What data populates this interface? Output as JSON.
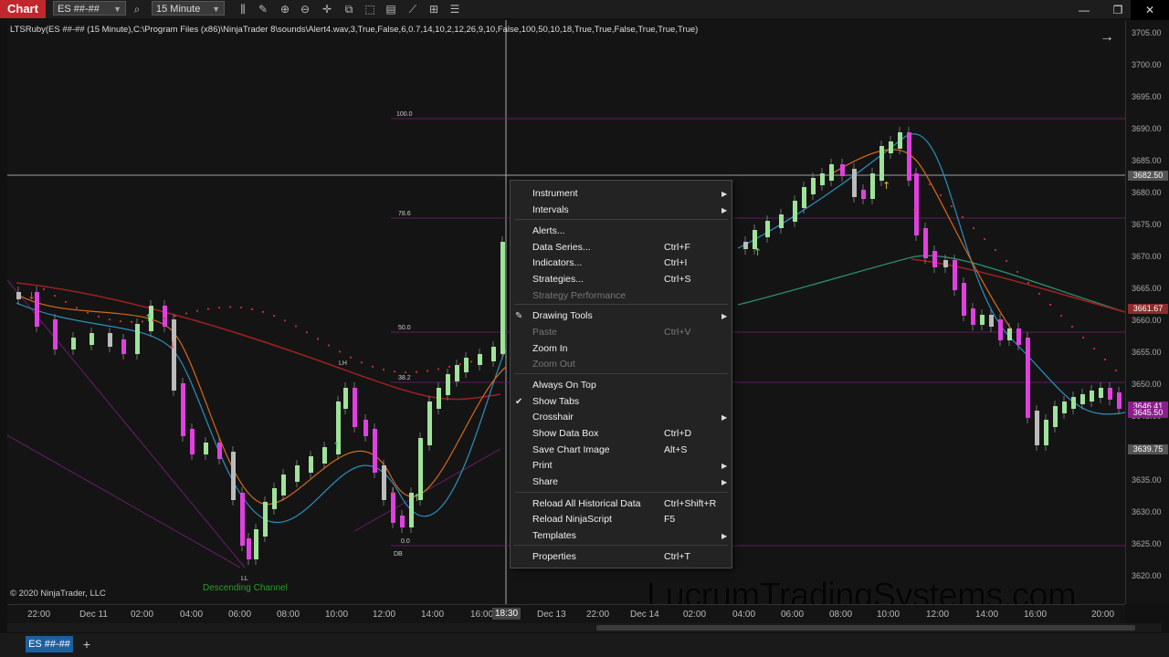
{
  "titlebar": {
    "app_tab": "Chart",
    "instrument": "ES ##-##",
    "interval": "15 Minute",
    "minimize": "—",
    "restore": "❐",
    "close": "✕"
  },
  "chart": {
    "indicator_label": "LTSRuby(ES ##-## (15 Minute),C:\\Program Files (x86)\\NinjaTrader 8\\sounds\\Alert4.wav,3,True,False,6,0.7,14,10,2,12,26,9,10,False,100,50,10,18,True,True,False,True,True,True)",
    "copyright": "© 2020 NinjaTrader, LLC",
    "watermark": "LucrumTradingSystems.com",
    "descending_channel": "Descending Channel",
    "fib_levels": [
      "100.0",
      "78.6",
      "50.0",
      "38.2",
      "0.0"
    ],
    "swing_labels": [
      "LH",
      "LL",
      "DB"
    ],
    "colors": {
      "bull": "#9fe39a",
      "bear": "#e040e0",
      "neutral": "#bbbbbb",
      "level": "#8a1f8a"
    }
  },
  "price_axis": {
    "ticks": [
      "3705.00",
      "3700.00",
      "3695.00",
      "3690.00",
      "3685.00",
      "3680.00",
      "3675.00",
      "3670.00",
      "3665.00",
      "3660.00",
      "3655.00",
      "3650.00",
      "3645.00",
      "3640.00",
      "3635.00",
      "3630.00",
      "3625.00",
      "3620.00"
    ],
    "tags": [
      {
        "value": "3682.50",
        "color": "#555555"
      },
      {
        "value": "3661.67",
        "color": "#8b2d2d"
      },
      {
        "value": "3646.41",
        "color": "#8a1f8a"
      },
      {
        "value": "3645.50",
        "color": "#8a1f8a"
      },
      {
        "value": "3639.75",
        "color": "#555555"
      }
    ]
  },
  "time_axis": {
    "ticks": [
      "22:00",
      "Dec 11",
      "02:00",
      "04:00",
      "06:00",
      "08:00",
      "10:00",
      "12:00",
      "14:00",
      "16:00",
      "Dec 13",
      "22:00",
      "Dec 14",
      "02:00",
      "04:00",
      "06:00",
      "08:00",
      "10:00",
      "12:00",
      "14:00",
      "16:00",
      "20:00"
    ],
    "cursor": "18:30"
  },
  "tabs": {
    "active": "ES ##-##",
    "add": "+"
  },
  "context_menu": {
    "items": [
      {
        "label": "Instrument",
        "shortcut": "",
        "submenu": true,
        "disabled": false,
        "check": false
      },
      {
        "label": "Intervals",
        "shortcut": "",
        "submenu": true,
        "disabled": false,
        "check": false
      },
      {
        "label": "Alerts...",
        "shortcut": "",
        "submenu": false,
        "disabled": false,
        "check": false
      },
      {
        "label": "Data Series...",
        "shortcut": "Ctrl+F",
        "submenu": false,
        "disabled": false,
        "check": false
      },
      {
        "label": "Indicators...",
        "shortcut": "Ctrl+I",
        "submenu": false,
        "disabled": false,
        "check": false
      },
      {
        "label": "Strategies...",
        "shortcut": "Ctrl+S",
        "submenu": false,
        "disabled": false,
        "check": false
      },
      {
        "label": "Strategy Performance",
        "shortcut": "",
        "submenu": false,
        "disabled": true,
        "check": false
      },
      {
        "label": "Drawing Tools",
        "shortcut": "",
        "submenu": true,
        "disabled": false,
        "check": false
      },
      {
        "label": "Paste",
        "shortcut": "Ctrl+V",
        "submenu": false,
        "disabled": true,
        "check": false
      },
      {
        "label": "Zoom In",
        "shortcut": "",
        "submenu": false,
        "disabled": false,
        "check": false
      },
      {
        "label": "Zoom Out",
        "shortcut": "",
        "submenu": false,
        "disabled": true,
        "check": false
      },
      {
        "label": "Always On Top",
        "shortcut": "",
        "submenu": false,
        "disabled": false,
        "check": false
      },
      {
        "label": "Show Tabs",
        "shortcut": "",
        "submenu": false,
        "disabled": false,
        "check": true
      },
      {
        "label": "Crosshair",
        "shortcut": "",
        "submenu": true,
        "disabled": false,
        "check": false
      },
      {
        "label": "Show Data Box",
        "shortcut": "Ctrl+D",
        "submenu": false,
        "disabled": false,
        "check": false
      },
      {
        "label": "Save Chart Image",
        "shortcut": "Alt+S",
        "submenu": false,
        "disabled": false,
        "check": false
      },
      {
        "label": "Print",
        "shortcut": "",
        "submenu": true,
        "disabled": false,
        "check": false
      },
      {
        "label": "Share",
        "shortcut": "",
        "submenu": true,
        "disabled": false,
        "check": false
      },
      {
        "label": "Reload All Historical Data",
        "shortcut": "Ctrl+Shift+R",
        "submenu": false,
        "disabled": false,
        "check": false
      },
      {
        "label": "Reload NinjaScript",
        "shortcut": "F5",
        "submenu": false,
        "disabled": false,
        "check": false
      },
      {
        "label": "Templates",
        "shortcut": "",
        "submenu": true,
        "disabled": false,
        "check": false
      },
      {
        "label": "Properties",
        "shortcut": "Ctrl+T",
        "submenu": false,
        "disabled": false,
        "check": false
      }
    ]
  }
}
